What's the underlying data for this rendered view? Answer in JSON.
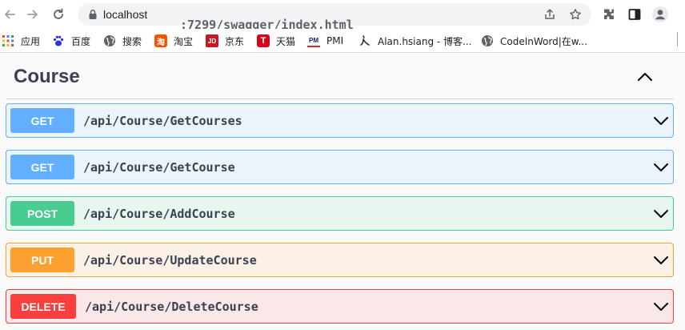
{
  "browser": {
    "url_host": "localhost",
    "url_path": ":7299/swagger/index.html"
  },
  "bookmarks": [
    {
      "label": "应用",
      "icon": "apps-grid-icon"
    },
    {
      "label": "百度",
      "icon": "baidu-paw-icon"
    },
    {
      "label": "搜索",
      "icon": "globe-icon"
    },
    {
      "label": "淘宝",
      "icon": "taobao-icon"
    },
    {
      "label": "京东",
      "icon": "jd-icon"
    },
    {
      "label": "天猫",
      "icon": "tmall-icon"
    },
    {
      "label": "PMI",
      "icon": "pmi-icon"
    },
    {
      "label": "Alan.hsiang - 博客...",
      "icon": "cnblogs-icon"
    },
    {
      "label": "CodeInWord|在w...",
      "icon": "globe-icon"
    }
  ],
  "favicon_text": {
    "taobao": "淘",
    "jd": "JD",
    "tmall": "T",
    "pmi": "PM"
  },
  "tag": {
    "title": "Course"
  },
  "operations": [
    {
      "method": "GET",
      "path": "/api/Course/GetCourses"
    },
    {
      "method": "GET",
      "path": "/api/Course/GetCourse"
    },
    {
      "method": "POST",
      "path": "/api/Course/AddCourse"
    },
    {
      "method": "PUT",
      "path": "/api/Course/UpdateCourse"
    },
    {
      "method": "DELETE",
      "path": "/api/Course/DeleteCourse"
    }
  ],
  "colors": {
    "get": "#61affe",
    "post": "#49cc90",
    "put": "#fca130",
    "delete": "#f93e3e"
  }
}
